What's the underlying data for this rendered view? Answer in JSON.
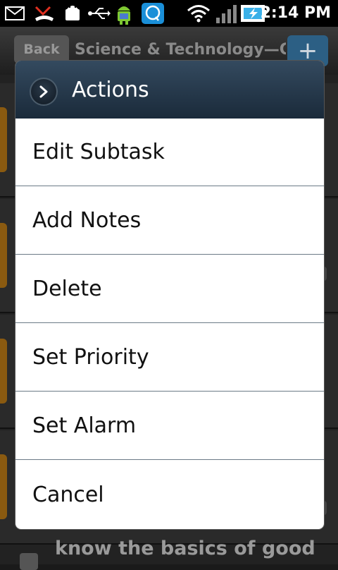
{
  "status_bar": {
    "time": "2:14 PM",
    "icons": [
      "email-icon",
      "missed-call-icon",
      "android-debug-icon",
      "usb-icon",
      "android-mascot-icon",
      "chat-app-icon",
      "wifi-icon",
      "signal-icon",
      "battery-charging-icon"
    ]
  },
  "app": {
    "back_label": "Back",
    "title": "Science & Technology—Cri",
    "add_label": "+",
    "bottom_text": "know the basics of good"
  },
  "dialog": {
    "title": "Actions",
    "items": [
      {
        "label": "Edit Subtask"
      },
      {
        "label": "Add Notes"
      },
      {
        "label": "Delete"
      },
      {
        "label": "Set Priority"
      },
      {
        "label": "Set Alarm"
      },
      {
        "label": "Cancel"
      }
    ]
  },
  "colors": {
    "dialog_header": "#223446",
    "add_button": "#2c5f84",
    "task_tab": "#8a5a10"
  }
}
